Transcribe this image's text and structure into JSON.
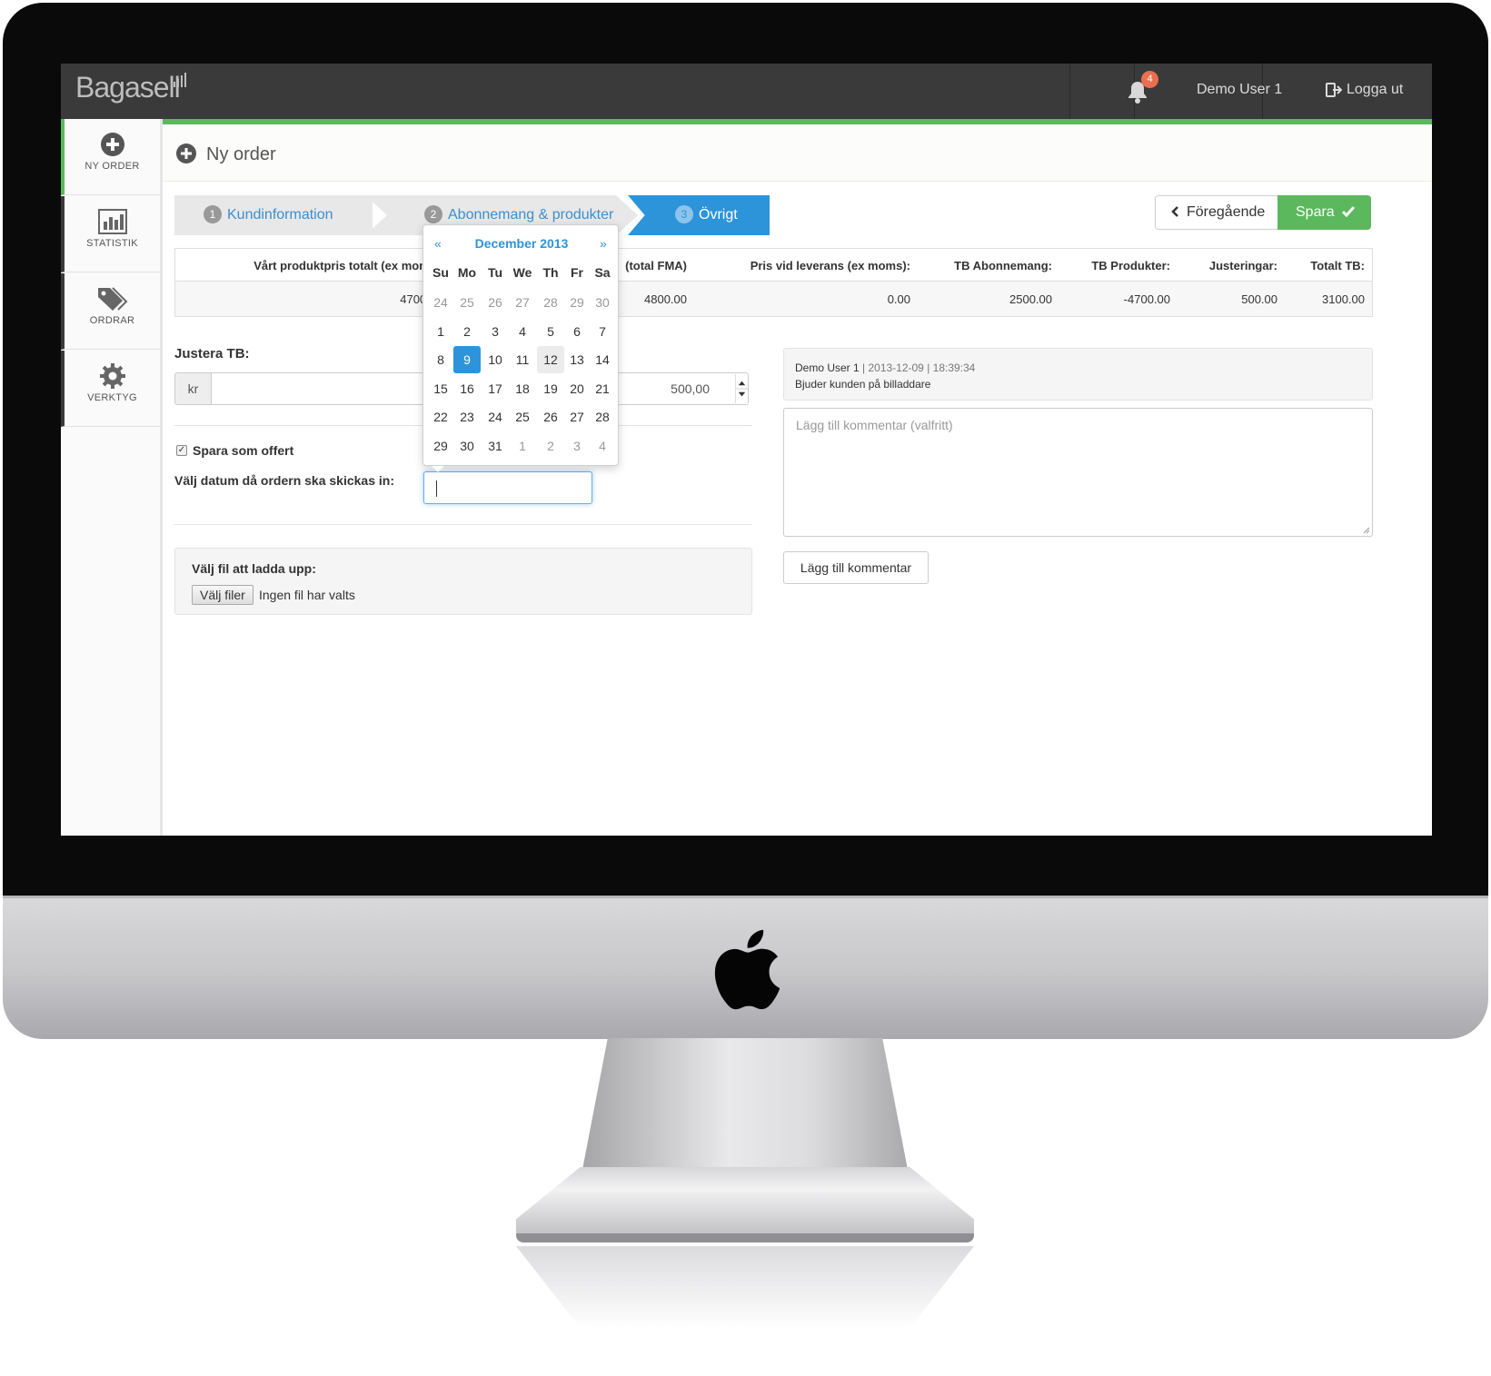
{
  "app": {
    "brand": "Bagasell",
    "notification_count": "4",
    "user": "Demo User 1",
    "logout": "Logga ut"
  },
  "sidebar": {
    "items": [
      {
        "label": "NY ORDER",
        "icon": "plus-circle-icon",
        "active": true
      },
      {
        "label": "STATISTIK",
        "icon": "bar-chart-icon",
        "active": false
      },
      {
        "label": "ORDRAR",
        "icon": "tags-icon",
        "active": false
      },
      {
        "label": "VERKTYG",
        "icon": "gear-icon",
        "active": false
      }
    ]
  },
  "page": {
    "title": "Ny order"
  },
  "wizard": {
    "steps": [
      {
        "num": "1",
        "label": "Kundinformation"
      },
      {
        "num": "2",
        "label": "Abonnemang & produkter"
      },
      {
        "num": "3",
        "label": "Övrigt"
      }
    ],
    "active_step": 3,
    "prev_label": "Föregående",
    "save_label": "Spara"
  },
  "summary": {
    "headers": [
      "Vårt produktpris totalt (ex moms",
      "(total FMA)",
      "Pris vid leverans (ex moms):",
      "TB Abonnemang:",
      "TB Produkter:",
      "Justeringar:",
      "Totalt TB:"
    ],
    "values": [
      "4700.0",
      "4800.00",
      "0.00",
      "2500.00",
      "-4700.00",
      "500.00",
      "3100.00"
    ]
  },
  "justera": {
    "label": "Justera TB:",
    "addon": "kr",
    "value": "500,00"
  },
  "offer": {
    "checkbox_label": "Spara som offert",
    "checked": true,
    "date_label": "Välj datum då ordern ska skickas in:",
    "date_value": ""
  },
  "upload": {
    "label": "Välj fil att ladda upp:",
    "button": "Välj filer",
    "status": "Ingen fil har valts"
  },
  "comments": {
    "items": [
      {
        "user": "Demo User 1",
        "meta": " | 2013-12-09 | 18:39:34",
        "text": "Bjuder kunden på billaddare"
      }
    ],
    "placeholder": "Lägg till kommentar (valfritt)",
    "add_button": "Lägg till kommentar"
  },
  "datepicker": {
    "prev": "«",
    "next": "»",
    "title": "December 2013",
    "dow": [
      "Su",
      "Mo",
      "Tu",
      "We",
      "Th",
      "Fr",
      "Sa"
    ],
    "weeks": [
      [
        "24",
        "25",
        "26",
        "27",
        "28",
        "29",
        "30"
      ],
      [
        "1",
        "2",
        "3",
        "4",
        "5",
        "6",
        "7"
      ],
      [
        "8",
        "9",
        "10",
        "11",
        "12",
        "13",
        "14"
      ],
      [
        "15",
        "16",
        "17",
        "18",
        "19",
        "20",
        "21"
      ],
      [
        "22",
        "23",
        "24",
        "25",
        "26",
        "27",
        "28"
      ],
      [
        "29",
        "30",
        "31",
        "1",
        "2",
        "3",
        "4"
      ]
    ],
    "selected_day": "9",
    "today_day": "12"
  }
}
